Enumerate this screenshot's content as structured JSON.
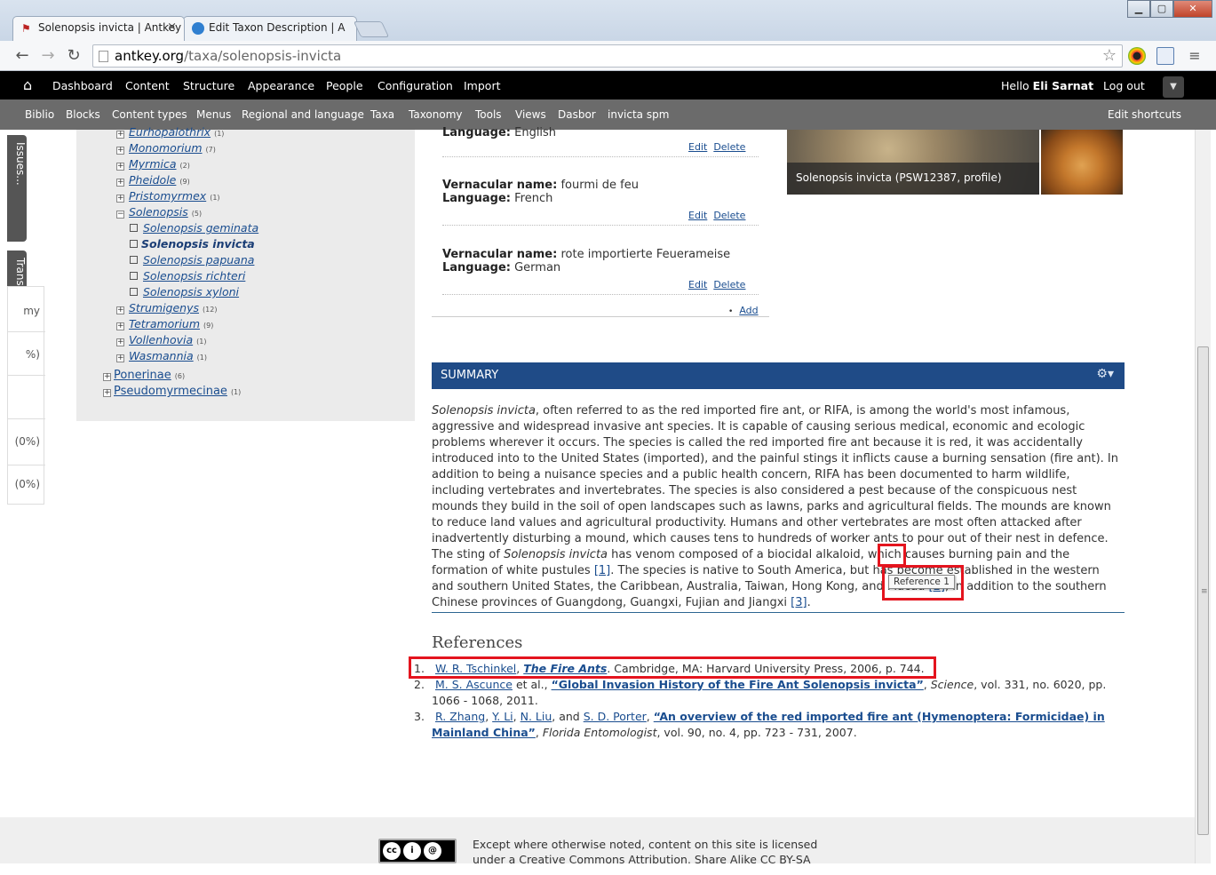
{
  "browser": {
    "tabs": [
      {
        "label": "Solenopsis invicta | Antkey",
        "close": "×"
      },
      {
        "label": "Edit Taxon Description | A",
        "close": ""
      }
    ],
    "url_host": "antkey.org",
    "url_path": "/taxa/solenopsis-invicta",
    "window_controls": {
      "minimize": "▁",
      "maximize": "▢",
      "close": "✕"
    }
  },
  "toolbar": {
    "items": [
      "Dashboard",
      "Content",
      "Structure",
      "Appearance",
      "People",
      "Configuration",
      "Import"
    ],
    "hello": "Hello",
    "user": "Eli Sarnat",
    "logout": "Log out"
  },
  "shortcuts": {
    "items": [
      "Biblio",
      "Blocks",
      "Content types",
      "Menus",
      "Regional and language",
      "Taxa",
      "Taxonomy",
      "Tools",
      "Views",
      "Dasbor",
      "invicta spm"
    ],
    "edit": "Edit shortcuts"
  },
  "side_tabs": {
    "issues": "Issues...",
    "translate": "Translate..."
  },
  "side_panel": [
    "my",
    "%)",
    "(0%)",
    "(0%)"
  ],
  "tree": [
    {
      "label": "Eurhopalothrix",
      "count": "(1)",
      "level": 1,
      "type": "collapsed"
    },
    {
      "label": "Monomorium",
      "count": "(7)",
      "level": 1,
      "type": "collapsed"
    },
    {
      "label": "Myrmica",
      "count": "(2)",
      "level": 1,
      "type": "collapsed"
    },
    {
      "label": "Pheidole",
      "count": "(9)",
      "level": 1,
      "type": "collapsed"
    },
    {
      "label": "Pristomyrmex",
      "count": "(1)",
      "level": 1,
      "type": "collapsed"
    },
    {
      "label": "Solenopsis",
      "count": "(5)",
      "level": 1,
      "type": "expanded"
    },
    {
      "label": "Solenopsis geminata",
      "count": "",
      "level": 2,
      "type": "leaf"
    },
    {
      "label": "Solenopsis invicta",
      "count": "",
      "level": 2,
      "type": "current"
    },
    {
      "label": "Solenopsis papuana",
      "count": "",
      "level": 2,
      "type": "leaf"
    },
    {
      "label": "Solenopsis richteri",
      "count": "",
      "level": 2,
      "type": "leaf"
    },
    {
      "label": "Solenopsis xyloni",
      "count": "",
      "level": 2,
      "type": "leaf"
    },
    {
      "label": "Strumigenys",
      "count": "(12)",
      "level": 1,
      "type": "collapsed"
    },
    {
      "label": "Tetramorium",
      "count": "(9)",
      "level": 1,
      "type": "collapsed"
    },
    {
      "label": "Vollenhovia",
      "count": "(1)",
      "level": 1,
      "type": "collapsed"
    },
    {
      "label": "Wasmannia",
      "count": "(1)",
      "level": 1,
      "type": "collapsed"
    },
    {
      "label": "Ponerinae",
      "count": "(6)",
      "level": 0,
      "type": "collapsed"
    },
    {
      "label": "Pseudomyrmecinae",
      "count": "(1)",
      "level": 0,
      "type": "collapsed"
    }
  ],
  "vernacular": {
    "first_language_label": "Language:",
    "first_language": "English",
    "entries": [
      {
        "name_label": "Vernacular name:",
        "name": "fourmi de feu",
        "language_label": "Language:",
        "language": "French"
      },
      {
        "name_label": "Vernacular name:",
        "name": "rote importierte Feuerameise",
        "language_label": "Language:",
        "language": "German"
      }
    ],
    "edit": "Edit",
    "delete": "Delete",
    "add": "Add",
    "bullet": "•"
  },
  "image": {
    "caption": "Solenopsis invicta (PSW12387, profile)"
  },
  "summary": {
    "title": "SUMMARY",
    "gear": "⚙▾",
    "species": "Solenopsis invicta",
    "text_1": ", often referred to as the red imported fire ant, or RIFA, is among the world's most infamous, aggressive and widespread invasive ant species. It is capable of causing serious medical, economic and ecologic problems wherever it occurs. The species is called the red imported fire ant because it is red, it was accidentally introduced into to the United States (imported), and the painful stings it inflicts cause a burning sensation (fire ant). In addition to being a nuisance species and a public health concern, RIFA has been documented to harm wildlife, including vertebrates and invertebrates. The species is also considered a pest because of the conspicuous nest mounds they build in the soil of open landscapes such as lawns, parks and agricultural fields. The mounds are known to reduce land values and agricultural productivity. Humans and other vertebrates are most often attacked after inadvertently disturbing a mound, which causes tens to hundreds of worker ants to pour out of their nest in defence. The sting of ",
    "species_2": "Solenopsis invicta",
    "text_2": " has venom composed of a biocidal alkaloid, which causes burning pain and the formation of white pustules ",
    "ref1": "[1]",
    "text_3": ". The species is native to South America, but has become established in the western and southern United States, the Caribbean, Australia, Taiwan, Hong Kong, and Macau ",
    "ref2": "[2]",
    "text_4": ", in addition to the southern Chinese provinces of Guangdong, Guangxi, Fujian and Jiangxi ",
    "ref3": "[3]",
    "text_5": ".",
    "tooltip": "Reference 1"
  },
  "references": {
    "title": "References",
    "items": [
      {
        "num": "1.",
        "author": "W. R. Tschinkel",
        "sep1": ", ",
        "title": "The Fire Ants",
        "rest": ". Cambridge, MA: Harvard University Press, 2006, p. 744."
      },
      {
        "num": "2.",
        "author": "M. S. Ascunce",
        "sep1": " et al., ",
        "title": "“Global Invasion History of the Fire Ant Solenopsis invicta”",
        "journal": "Science",
        "rest": ", vol. 331, no. 6020, pp. 1066 - 1068, 2011."
      },
      {
        "num": "3.",
        "authors": [
          "R. Zhang",
          "Y. Li",
          "N. Liu",
          "S. D. Porter"
        ],
        "title": "“An overview of the red imported fire ant (Hymenoptera: Formicidae) in Mainland China”",
        "journal": "Florida Entomologist",
        "rest": ", vol. 90, no. 4, pp. 723 - 731, 2007."
      }
    ]
  },
  "footer": {
    "text": "Except where otherwise noted, content on this site is licensed under a Creative Commons Attribution, Share Alike CC BY-SA",
    "badge": [
      "cc",
      "i",
      "@"
    ]
  },
  "colors": {
    "toolbar": "#000000",
    "shortcuts": "#6b6b6b",
    "summary_header": "#1f4b87",
    "highlight": "#e4141e",
    "link": "#1a4d8f"
  }
}
